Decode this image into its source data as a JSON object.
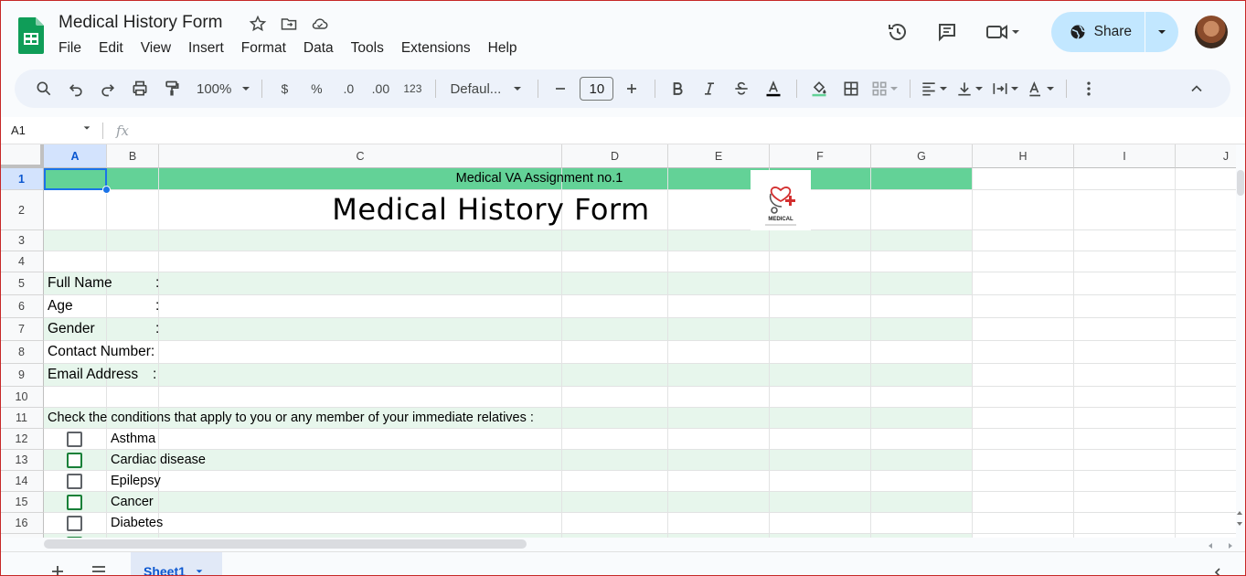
{
  "app": {
    "doc_title": "Medical History Form",
    "menu": [
      "File",
      "Edit",
      "View",
      "Insert",
      "Format",
      "Data",
      "Tools",
      "Extensions",
      "Help"
    ],
    "share_label": "Share"
  },
  "toolbar": {
    "zoom": "100%",
    "currency": "$",
    "percent": "%",
    "dec_dec": ".0",
    "inc_dec": ".00",
    "format_123": "123",
    "font_name": "Defaul...",
    "font_size": "10"
  },
  "formula_bar": {
    "name_box": "A1",
    "fx": "fx"
  },
  "sheet": {
    "columns": [
      "A",
      "B",
      "C",
      "D",
      "E",
      "F",
      "G",
      "H",
      "I",
      "J"
    ],
    "rows": [
      "1",
      "2",
      "3",
      "4",
      "5",
      "6",
      "7",
      "8",
      "9",
      "10",
      "11",
      "12",
      "13",
      "14",
      "15",
      "16"
    ],
    "subtitle": "Medical VA Assignment no.1",
    "form_title": "Medical History Form",
    "logo_text": "MEDICAL",
    "fields": [
      {
        "label": "Full Name",
        "colon": ":"
      },
      {
        "label": "Age",
        "colon": ":"
      },
      {
        "label": "Gender",
        "colon": ":"
      },
      {
        "label": "Contact Number:",
        "colon": ""
      },
      {
        "label": "Email Address",
        "colon": ":"
      }
    ],
    "instruction": "Check the conditions that apply to you or any member of your immediate relatives :",
    "conditions": [
      {
        "label": "Asthma"
      },
      {
        "label": "Cardiac disease"
      },
      {
        "label": "Epilepsy"
      },
      {
        "label": "Cancer"
      },
      {
        "label": "Diabetes"
      }
    ]
  },
  "tabs": {
    "active": "Sheet1"
  },
  "colors": {
    "band_dark": "#63d297",
    "band_light": "#e7f6ec",
    "accent": "#0b57d0",
    "share_bg": "#c2e7ff"
  }
}
